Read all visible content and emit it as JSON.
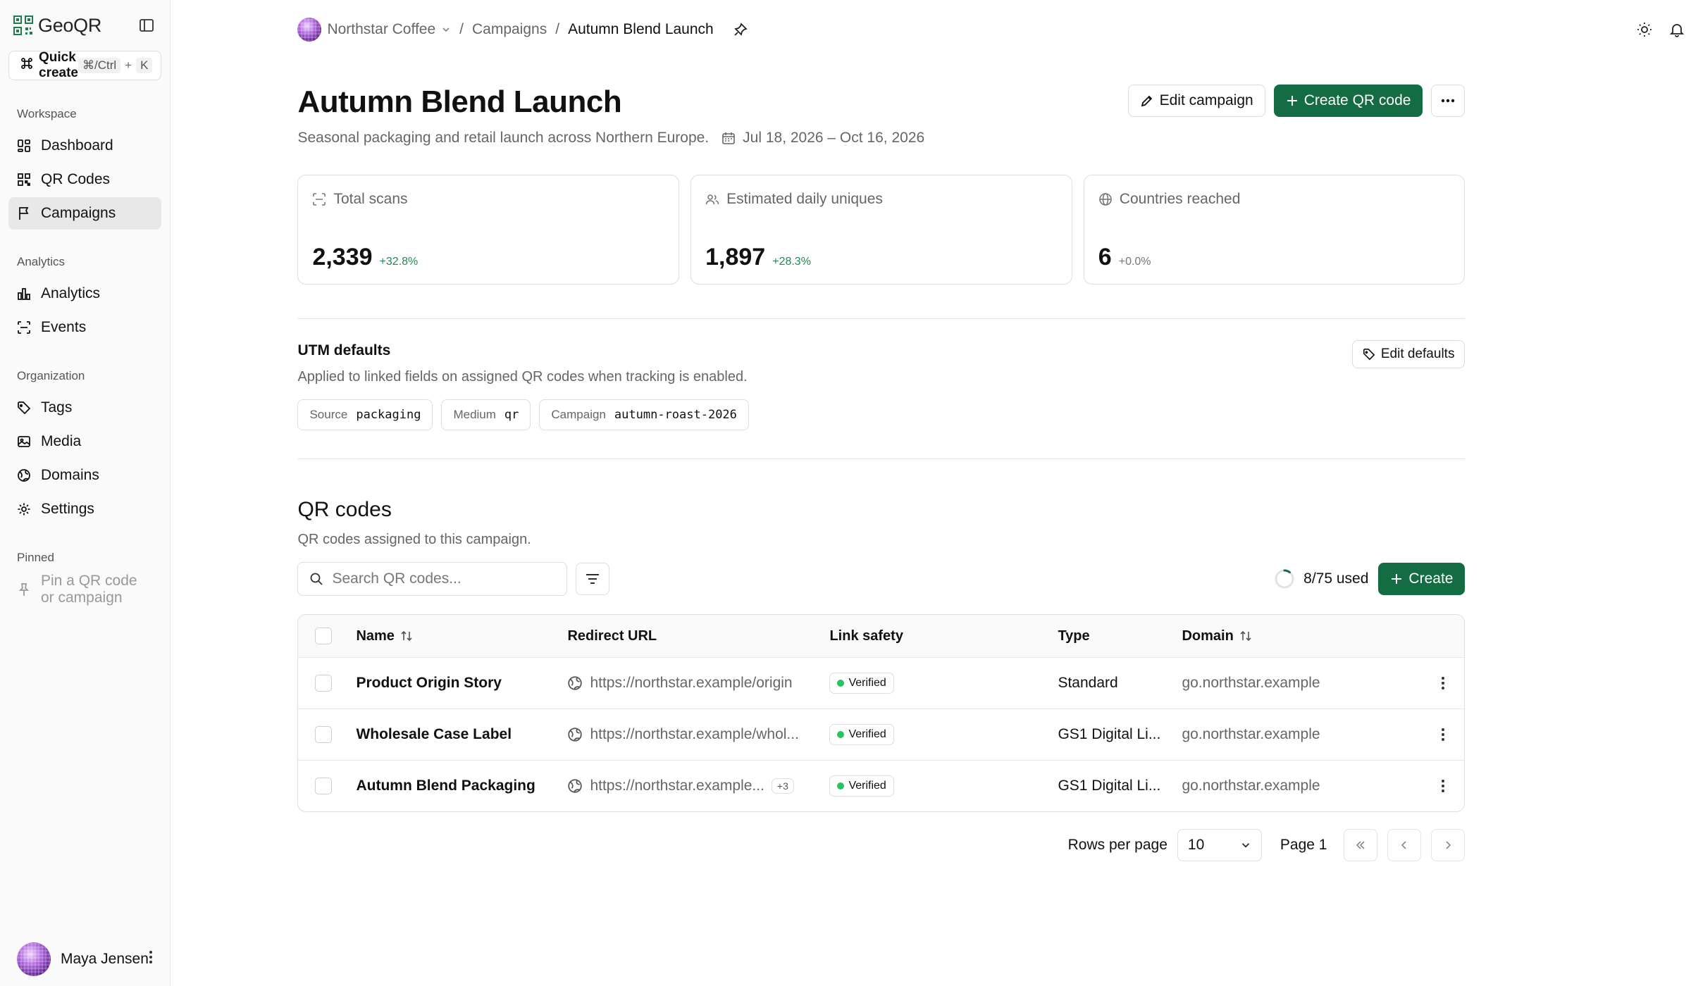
{
  "brand": {
    "name": "GeoQR"
  },
  "quick_create": {
    "label": "Quick create",
    "shortcut": "⌘/Ctrl",
    "plus": "+",
    "key": "K"
  },
  "sidebar": {
    "sections": [
      {
        "label": "Workspace",
        "items": [
          {
            "label": "Dashboard",
            "icon": "dashboard-icon"
          },
          {
            "label": "QR Codes",
            "icon": "qr-icon"
          },
          {
            "label": "Campaigns",
            "icon": "flag-icon",
            "active": true
          }
        ]
      },
      {
        "label": "Analytics",
        "items": [
          {
            "label": "Analytics",
            "icon": "bar-chart-icon"
          },
          {
            "label": "Events",
            "icon": "scan-icon"
          }
        ]
      },
      {
        "label": "Organization",
        "items": [
          {
            "label": "Tags",
            "icon": "tag-icon"
          },
          {
            "label": "Media",
            "icon": "image-icon"
          },
          {
            "label": "Domains",
            "icon": "globe-icon"
          },
          {
            "label": "Settings",
            "icon": "gear-icon"
          }
        ]
      },
      {
        "label": "Pinned",
        "items": [
          {
            "label": "Pin a QR code or campaign",
            "icon": "pin-icon",
            "muted": true
          }
        ]
      }
    ],
    "user": {
      "name": "Maya Jensen"
    }
  },
  "breadcrumb": {
    "org": "Northstar Coffee",
    "sep": "/",
    "section": "Campaigns",
    "current": "Autumn Blend Launch"
  },
  "campaign": {
    "title": "Autumn Blend Launch",
    "description": "Seasonal packaging and retail launch across Northern Europe.",
    "date_range": "Jul 18, 2026 – Oct 16, 2026",
    "edit_label": "Edit campaign",
    "create_label": "Create QR code"
  },
  "stats": [
    {
      "label": "Total scans",
      "value": "2,339",
      "delta": "+32.8%",
      "icon": "scan-icon"
    },
    {
      "label": "Estimated daily uniques",
      "value": "1,897",
      "delta": "+28.3%",
      "icon": "users-icon"
    },
    {
      "label": "Countries reached",
      "value": "6",
      "delta": "+0.0%",
      "icon": "globe-icon"
    }
  ],
  "utm": {
    "title": "UTM defaults",
    "description": "Applied to linked fields on assigned QR codes when tracking is enabled.",
    "edit_label": "Edit defaults",
    "chips": [
      {
        "key": "Source",
        "value": "packaging"
      },
      {
        "key": "Medium",
        "value": "qr"
      },
      {
        "key": "Campaign",
        "value": "autumn-roast-2026"
      }
    ]
  },
  "qr_section": {
    "title": "QR codes",
    "description": "QR codes assigned to this campaign.",
    "search_placeholder": "Search QR codes...",
    "usage": "8/75 used",
    "usage_fraction": 0.1067,
    "create_label": "Create",
    "columns": {
      "name": "Name",
      "url": "Redirect URL",
      "safety": "Link safety",
      "type": "Type",
      "domain": "Domain"
    },
    "rows": [
      {
        "name": "Product Origin Story",
        "url": "https://northstar.example/origin",
        "extra": "",
        "safety": "Verified",
        "type": "Standard",
        "domain": "go.northstar.example"
      },
      {
        "name": "Wholesale Case Label",
        "url": "https://northstar.example/whol...",
        "extra": "",
        "safety": "Verified",
        "type": "GS1 Digital Li...",
        "domain": "go.northstar.example"
      },
      {
        "name": "Autumn Blend Packaging",
        "url": "https://northstar.example...",
        "extra": "+3",
        "safety": "Verified",
        "type": "GS1 Digital Li...",
        "domain": "go.northstar.example"
      }
    ]
  },
  "pagination": {
    "rows_label": "Rows per page",
    "rows_value": "10",
    "page_label": "Page 1"
  },
  "colors": {
    "primary": "#146c43",
    "verified": "#22c55e",
    "delta_positive": "#1f8a55"
  }
}
